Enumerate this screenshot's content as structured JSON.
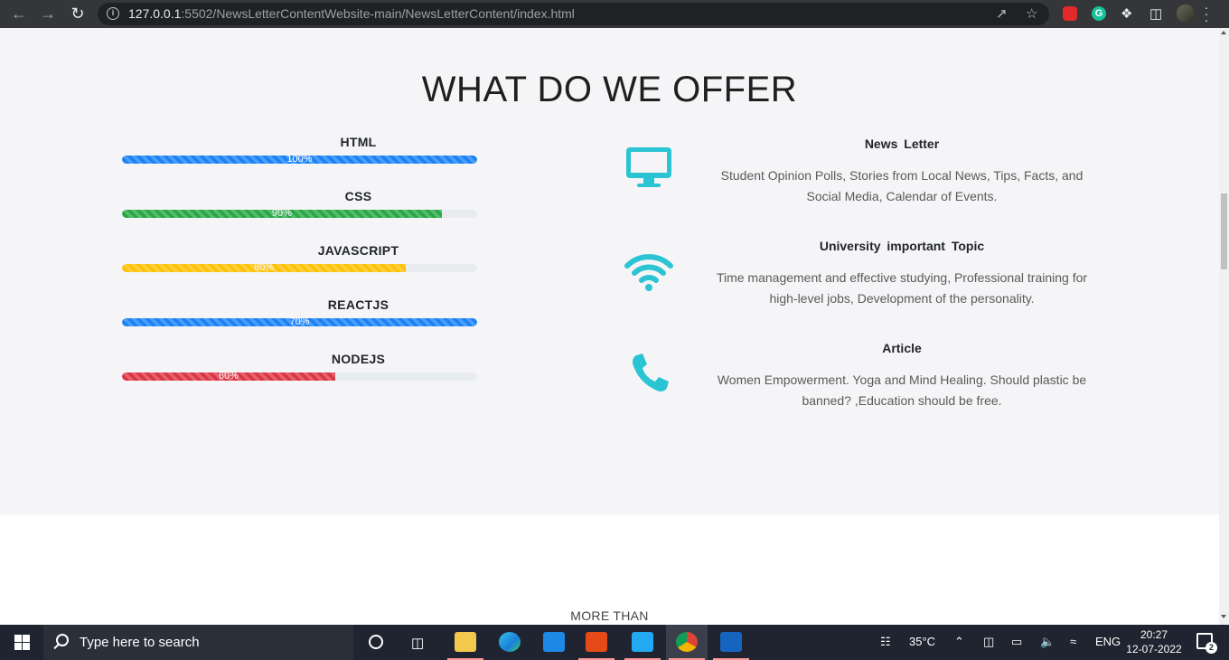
{
  "browser": {
    "url_host": "127.0.0.1",
    "url_rest": ":5502/NewsLetterContentWebsite-main/NewsLetterContent/index.html"
  },
  "section": {
    "title": "WHAT DO WE OFFER"
  },
  "skills": [
    {
      "name": "HTML",
      "percent_label": "100%",
      "value": 100,
      "color": "#1a82f7"
    },
    {
      "name": "CSS",
      "percent_label": "90%",
      "value": 90,
      "color": "#28a745"
    },
    {
      "name": "JAVASCRIPT",
      "percent_label": "80%",
      "value": 80,
      "color": "#ffc107"
    },
    {
      "name": "REACTJS",
      "percent_label": "70%",
      "value": 100,
      "color": "#1a82f7"
    },
    {
      "name": "NODEJS",
      "percent_label": "60%",
      "value": 60,
      "color": "#dc3545"
    }
  ],
  "offers": [
    {
      "icon": "desktop-icon",
      "title": "News  Letter",
      "description": "Student Opinion Polls, Stories from Local News, Tips, Facts, and Social Media, Calendar of Events."
    },
    {
      "icon": "wifi-icon",
      "title": "University  important  Topic",
      "description": "Time management and effective studying, Professional training for high-level jobs, Development of the personality."
    },
    {
      "icon": "phone-icon",
      "title": "Article",
      "description": "Women Empowerment. Yoga and Mind Healing. Should plastic be banned? ,Education should be free."
    }
  ],
  "next_section": {
    "label": "MORE THAN"
  },
  "taskbar": {
    "search_placeholder": "Type here to search",
    "weather": "35°C",
    "language": "ENG",
    "time": "20:27",
    "date": "12-07-2022",
    "notification_count": "2"
  },
  "colors": {
    "accent_icon": "#2bc4d3",
    "section_bg": "#f5f5f7"
  }
}
